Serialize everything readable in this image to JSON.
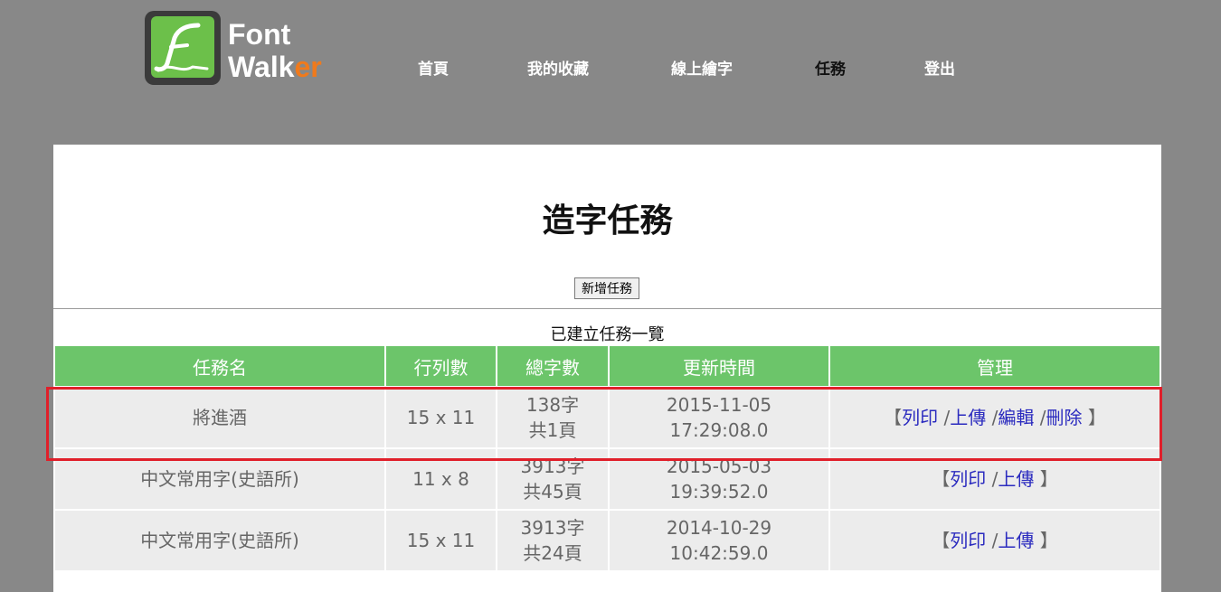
{
  "logo": {
    "line1": "Font",
    "line2_main": "Walk",
    "line2_accent": "er",
    "icon": "pen-f-icon"
  },
  "nav": {
    "items": [
      {
        "label": "首頁",
        "active": false
      },
      {
        "label": "我的收藏",
        "active": false
      },
      {
        "label": "線上繪字",
        "active": false
      },
      {
        "label": "任務",
        "active": true
      },
      {
        "label": "登出",
        "active": false
      }
    ]
  },
  "main": {
    "title": "造字任務",
    "new_button": "新增任務",
    "list_title": "已建立任務一覽"
  },
  "table": {
    "headers": [
      "任務名",
      "行列數",
      "總字數",
      "更新時間",
      "管理"
    ],
    "rows": [
      {
        "name": "將進酒",
        "grid": "15 x 11",
        "chars": "138字",
        "pages": "共1頁",
        "date": "2015-11-05",
        "time": "17:29:08.0",
        "open": "【",
        "print": "列印",
        "upload": "上傳",
        "edit": "編輯",
        "delete": "刪除",
        "close": "】",
        "sep": "/"
      },
      {
        "name": "中文常用字(史語所)",
        "grid": "11 x 8",
        "chars": "3913字",
        "pages": "共45頁",
        "date": "2015-05-03",
        "time": "19:39:52.0",
        "open": "【",
        "print": "列印",
        "upload": "上傳",
        "close": "】",
        "sep": "/"
      },
      {
        "name": "中文常用字(史語所)",
        "grid": "15 x 11",
        "chars": "3913字",
        "pages": "共24頁",
        "date": "2014-10-29",
        "time": "10:42:59.0",
        "open": "【",
        "print": "列印",
        "upload": "上傳",
        "close": "】",
        "sep": "/"
      }
    ]
  },
  "colors": {
    "header_green": "#6cc56a",
    "highlight_red": "#e01f2a",
    "link_blue": "#2b2bbf",
    "accent_orange": "#f07a1c"
  }
}
